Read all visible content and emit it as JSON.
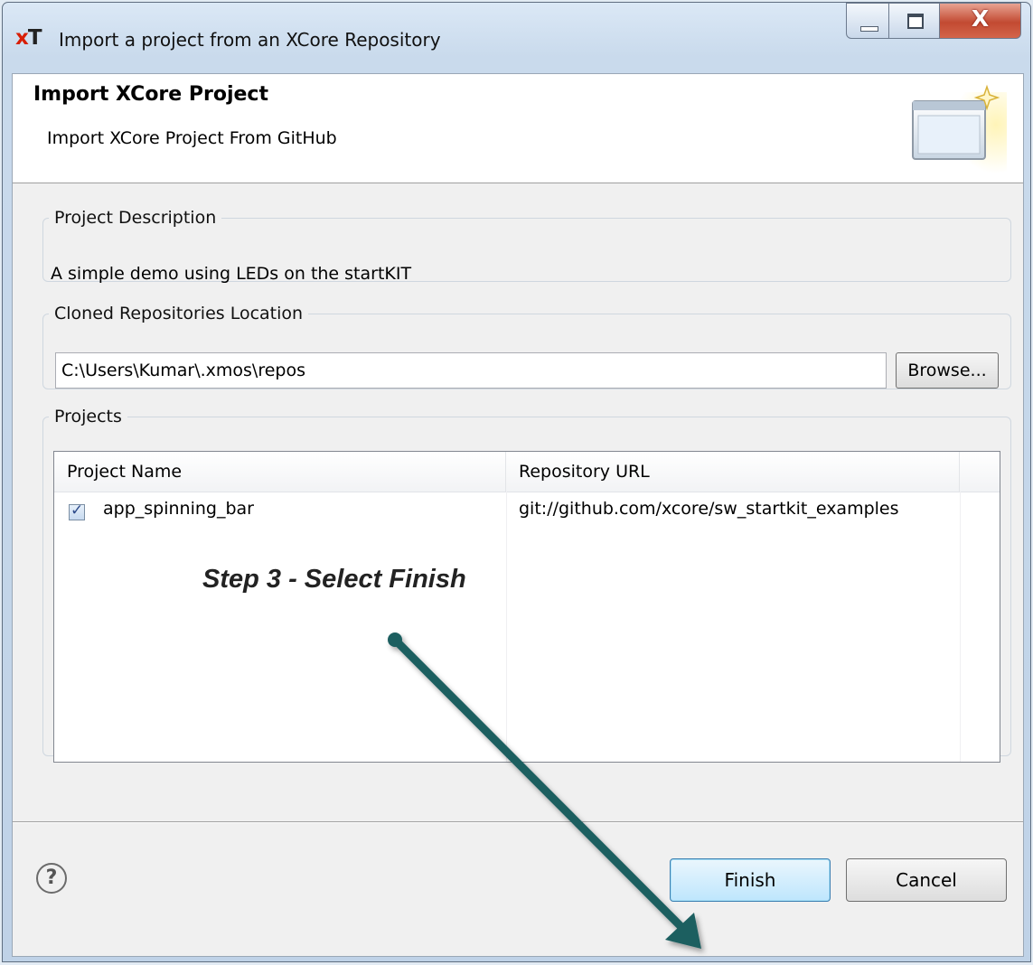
{
  "window": {
    "title": "Import a project from an XCore Repository",
    "logo_x": "x",
    "logo_t": "T",
    "close_glyph": "X"
  },
  "header": {
    "title": "Import XCore Project",
    "subtitle": "Import XCore Project From GitHub",
    "icon": "wizard-banner-icon"
  },
  "description_group": {
    "legend": "Project Description",
    "text": "A simple demo using LEDs on the startKIT"
  },
  "location_group": {
    "legend": "Cloned Repositories Location",
    "value": "C:\\Users\\Kumar\\.xmos\\repos",
    "browse_label": "Browse..."
  },
  "projects_group": {
    "legend": "Projects",
    "columns": [
      "Project Name",
      "Repository URL"
    ],
    "rows": [
      {
        "name": "app_spinning_bar",
        "url": "git://github.com/xcore/sw_startkit_examples",
        "checked": true
      }
    ]
  },
  "annotation": {
    "text": "Step 3 - Select Finish",
    "arrow_color": "#1e5f61"
  },
  "footer": {
    "help_icon": "?",
    "finish_label": "Finish",
    "cancel_label": "Cancel"
  }
}
